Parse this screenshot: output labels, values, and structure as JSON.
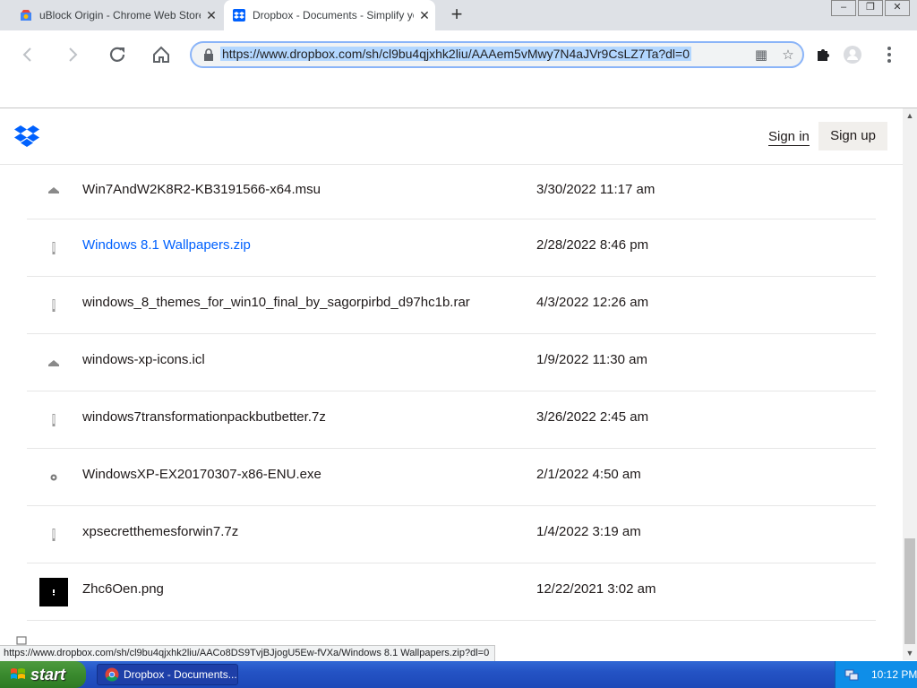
{
  "browser": {
    "tabs": [
      {
        "title": "uBlock Origin - Chrome Web Store",
        "active": false
      },
      {
        "title": "Dropbox - Documents - Simplify your",
        "active": true
      }
    ],
    "new_tab": "+",
    "window_buttons": {
      "minimize": "‒",
      "restore": "❐",
      "close": "✕"
    },
    "url": "https://www.dropbox.com/sh/cl9bu4qjxhk2liu/AAAem5vMwy7N4aJVr9CsLZ7Ta?dl=0",
    "status_url": "https://www.dropbox.com/sh/cl9bu4qjxhk2liu/AACo8DS9TvjBJjogU5Ew-fVXa/Windows 8.1 Wallpapers.zip?dl=0"
  },
  "header": {
    "sign_in": "Sign in",
    "sign_up": "Sign up"
  },
  "files": [
    {
      "name": "Win7AndW2K8R2-KB3191566-x64.msu",
      "date": "3/30/2022 11:17 am",
      "icon": "package-icon"
    },
    {
      "name": "Windows 8.1 Wallpapers.zip",
      "date": "2/28/2022 8:46 pm",
      "icon": "archive-icon",
      "hovered": true
    },
    {
      "name": "windows_8_themes_for_win10_final_by_sagorpirbd_d97hc1b.rar",
      "date": "4/3/2022 12:26 am",
      "icon": "archive-icon"
    },
    {
      "name": "windows-xp-icons.icl",
      "date": "1/9/2022 11:30 am",
      "icon": "package-icon"
    },
    {
      "name": "windows7transformationpackbutbetter.7z",
      "date": "3/26/2022 2:45 am",
      "icon": "archive-icon"
    },
    {
      "name": "WindowsXP-EX20170307-x86-ENU.exe",
      "date": "2/1/2022 4:50 am",
      "icon": "gear-icon"
    },
    {
      "name": "xpsecretthemesforwin7.7z",
      "date": "1/4/2022 3:19 am",
      "icon": "archive-icon"
    },
    {
      "name": "Zhc6Oen.png",
      "date": "12/22/2021 3:02 am",
      "icon": "image-thumbnail-icon"
    }
  ],
  "taskbar": {
    "start_label": "start",
    "task_label": "Dropbox - Documents...",
    "clock": "10:12 PM"
  },
  "colors": {
    "link_blue": "#0061fe",
    "dropbox_blue": "#0061fe",
    "xp_taskbar": "#2453c4",
    "xp_start_green": "#3a8a2e"
  }
}
